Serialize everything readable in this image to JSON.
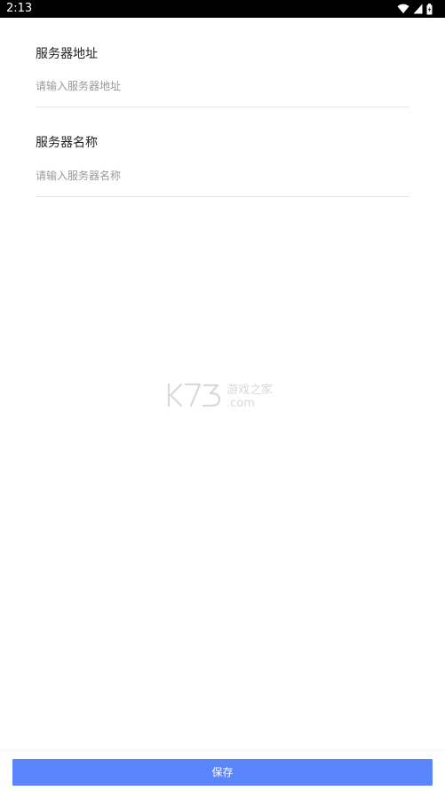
{
  "status_bar": {
    "time": "2:13",
    "icons": [
      "wifi-icon",
      "signal-icon",
      "battery-icon"
    ]
  },
  "form": {
    "server_address": {
      "label": "服务器地址",
      "placeholder": "请输入服务器地址",
      "value": ""
    },
    "server_name": {
      "label": "服务器名称",
      "placeholder": "请输入服务器名称",
      "value": ""
    }
  },
  "watermark": {
    "logo": "K73",
    "tagline": "游戏之家",
    "domain": ".com"
  },
  "actions": {
    "save_label": "保存"
  },
  "colors": {
    "status_bar_bg": "#000000",
    "label_text": "#222222",
    "placeholder_text": "#9a9a9a",
    "divider": "#e6e6e6",
    "primary_button": "#5b86fb"
  }
}
